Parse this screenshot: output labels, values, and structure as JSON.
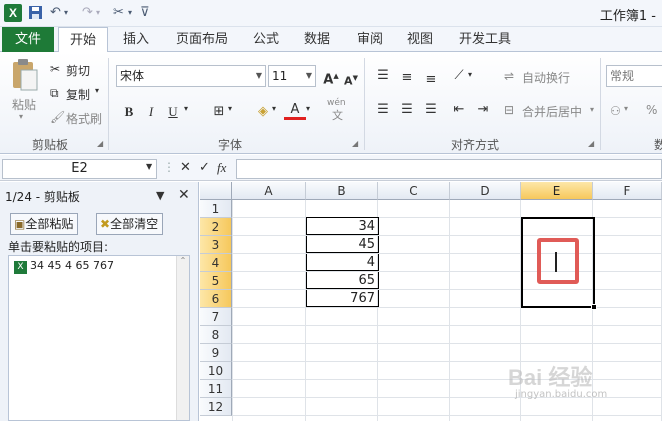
{
  "title": "工作簿1 -",
  "tabs": {
    "file": "文件",
    "home": "开始",
    "insert": "插入",
    "page_layout": "页面布局",
    "formulas": "公式",
    "data": "数据",
    "review": "审阅",
    "view": "视图",
    "developer": "开发工具"
  },
  "clipboard_group": {
    "paste": "粘贴",
    "cut": "剪切",
    "copy": "复制",
    "format_painter": "格式刷",
    "label": "剪贴板"
  },
  "font_group": {
    "font_name": "宋体",
    "font_size": "11",
    "bold": "B",
    "italic": "I",
    "underline": "U",
    "font_color_glyph": "A",
    "phonetic_glyph": "wén",
    "phonetic_glyph2": "文",
    "grow_glyph": "A",
    "shrink_glyph": "A",
    "label": "字体"
  },
  "align_group": {
    "wrap_text": "自动换行",
    "merge_center": "合并后居中",
    "label": "对齐方式"
  },
  "number_group": {
    "format": "常规",
    "percent": "%",
    "label_partial": "数"
  },
  "formula_bar": {
    "name_box": "E2",
    "fx": "fx"
  },
  "pane": {
    "title": "1/24 - 剪贴板",
    "paste_all": "全部粘贴",
    "clear_all": "全部清空",
    "hint": "单击要粘贴的项目:",
    "item": "34 45 4 65 767"
  },
  "grid": {
    "columns": [
      "A",
      "B",
      "C",
      "D",
      "E",
      "F"
    ],
    "rows": [
      "1",
      "2",
      "3",
      "4",
      "5",
      "6",
      "7",
      "8",
      "9",
      "10",
      "11",
      "12"
    ],
    "selected_column": "E",
    "selected_rows": [
      "2",
      "3",
      "4",
      "5",
      "6"
    ],
    "b_values": [
      "34",
      "45",
      "4",
      "65",
      "767"
    ]
  },
  "watermark": {
    "logo_text": "Bai 经验",
    "url": "jingyan.baidu.com"
  },
  "colors": {
    "file_tab": "#1e7a37",
    "selection_header": "#f6c85c",
    "highlight_box": "#e05b57"
  }
}
